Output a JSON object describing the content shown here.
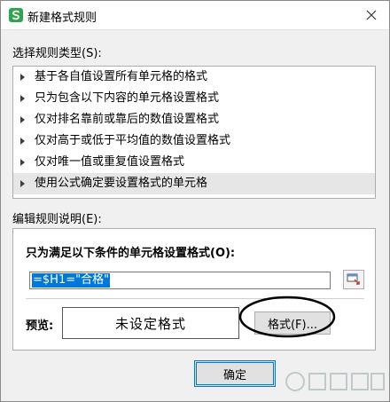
{
  "window": {
    "title": "新建格式规则"
  },
  "rule_type": {
    "label": "选择规则类型(S):",
    "items": [
      "基于各自值设置所有单元格的格式",
      "只为包含以下内容的单元格设置格式",
      "仅对排名靠前或靠后的数值设置格式",
      "仅对高于或低于平均值的数值设置格式",
      "仅对唯一值或重复值设置格式",
      "使用公式确定要设置格式的单元格"
    ],
    "selected_index": 5
  },
  "edit": {
    "label": "编辑规则说明(E):",
    "condition_label": "只为满足以下条件的单元格设置格式(O):",
    "formula_value": "=$H1=\"合格\"",
    "preview_label": "预览:",
    "preview_text": "未设定格式",
    "format_button": "格式(F)..."
  },
  "footer": {
    "ok_button": "确定"
  },
  "colors": {
    "accent": "#0078d7",
    "app_icon": "#2ea44f",
    "highlight_ellipse": "#000000"
  },
  "icons": {
    "app": "wps-s-icon",
    "close": "close-icon",
    "range": "range-select-icon"
  }
}
